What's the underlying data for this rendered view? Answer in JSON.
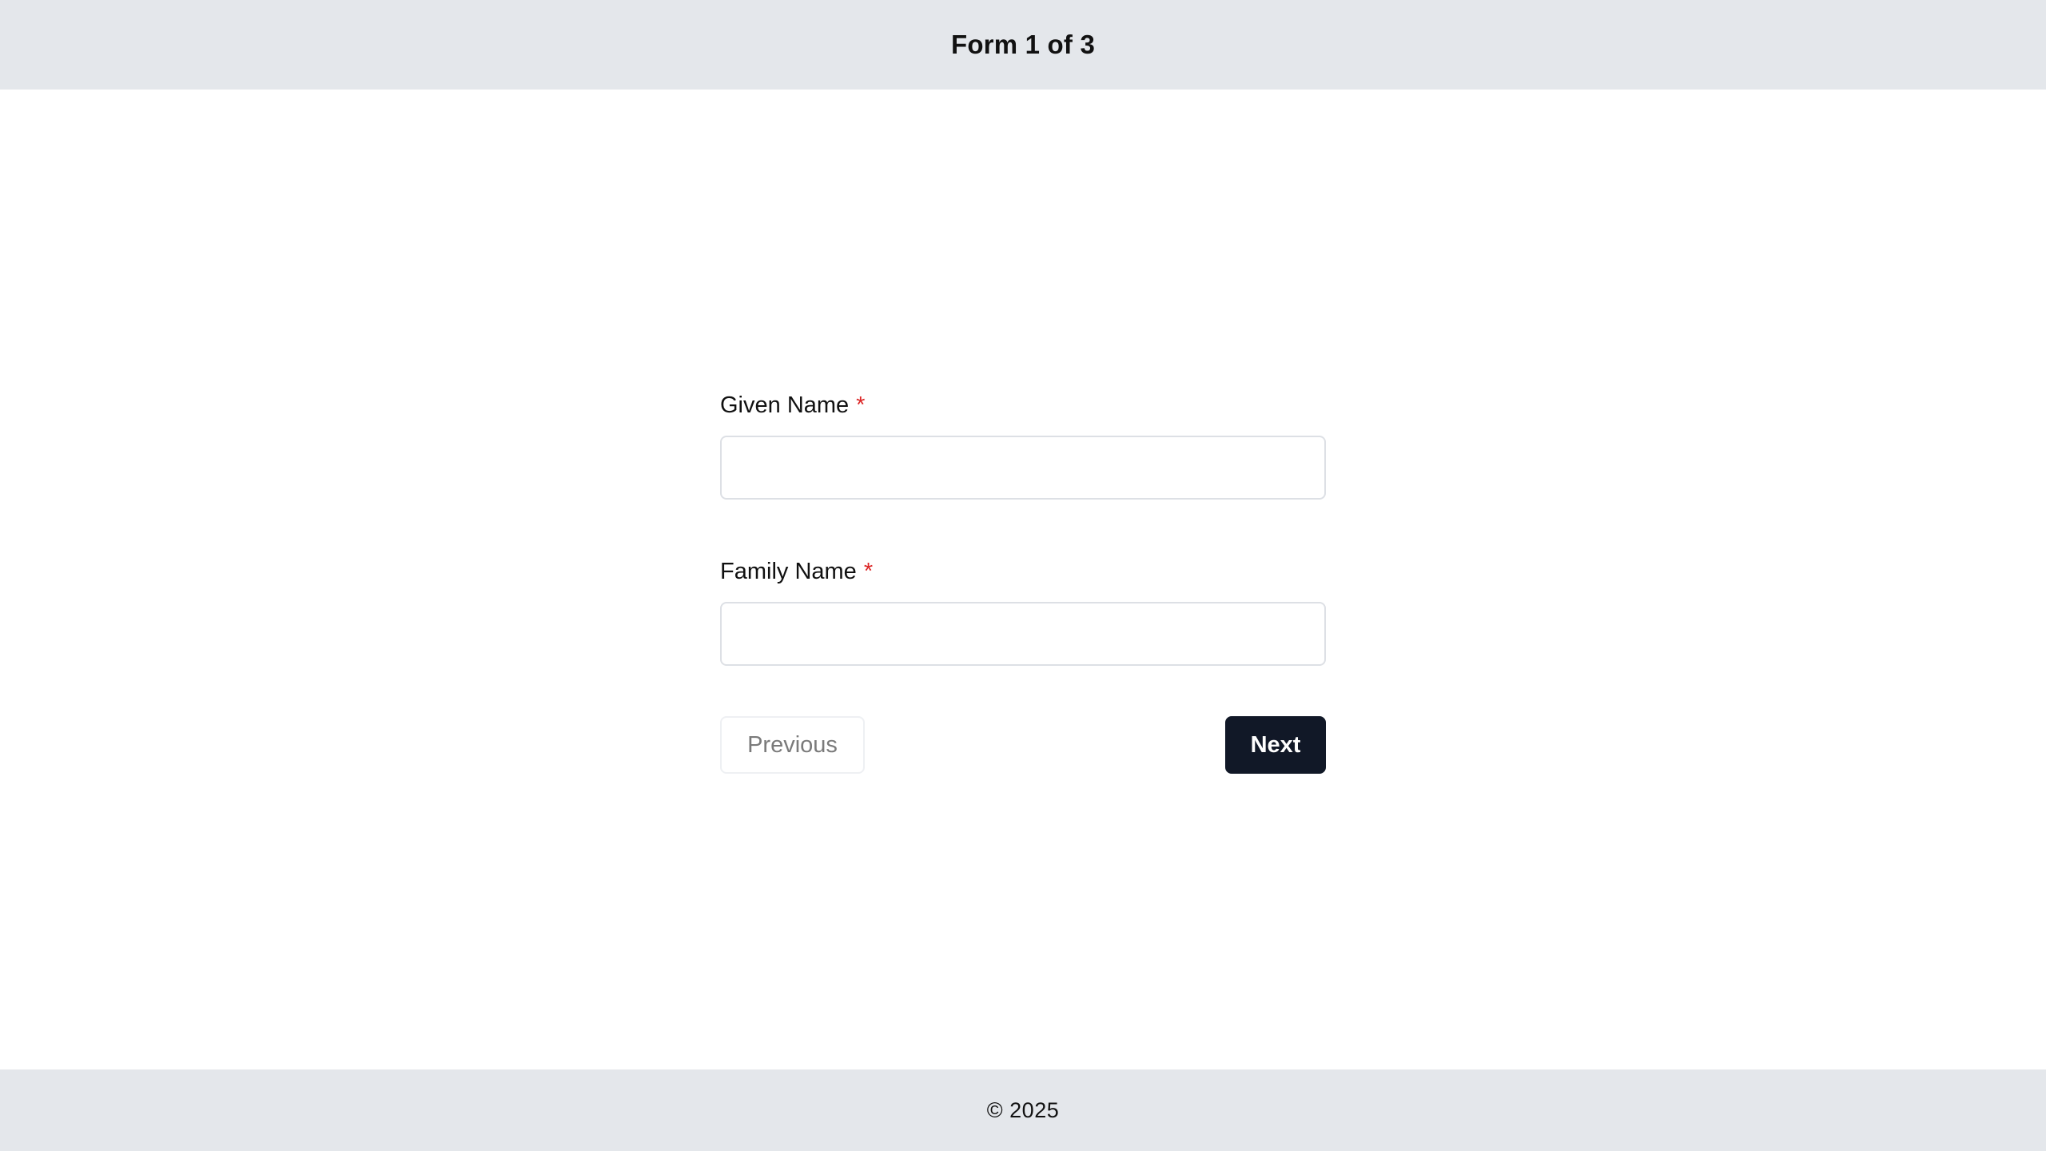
{
  "header": {
    "title": "Form 1 of 3"
  },
  "form": {
    "fields": [
      {
        "label": "Given Name",
        "required_mark": "*",
        "value": "",
        "placeholder": ""
      },
      {
        "label": "Family Name",
        "required_mark": "*",
        "value": "",
        "placeholder": ""
      }
    ],
    "actions": {
      "previous_label": "Previous",
      "next_label": "Next"
    }
  },
  "footer": {
    "text": "© 2025"
  },
  "colors": {
    "header_background": "#e4e7eb",
    "footer_background": "#e4e7eb",
    "required_mark": "#dc2626",
    "next_button_background": "#111827",
    "previous_button_text": "#7a7a7a"
  }
}
